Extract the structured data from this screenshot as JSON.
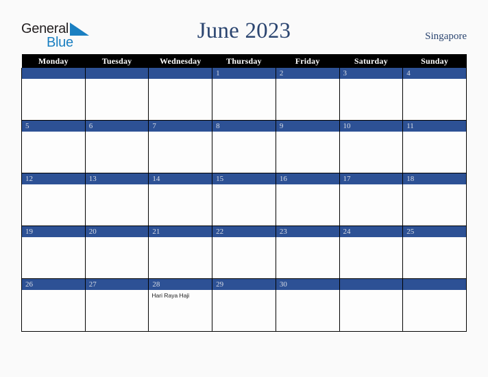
{
  "logo": {
    "line1": "General",
    "line2": "Blue",
    "triangle_color": "#1a7fc1",
    "text_color": "#231f20"
  },
  "header": {
    "title": "June 2023",
    "region": "Singapore",
    "title_color": "#2b4570"
  },
  "theme": {
    "band_blue": "#2d5195",
    "header_black": "#000000",
    "page_background": "#fafafa",
    "cell_background": "#fdfdfd",
    "daynum_color": "#d9dde6"
  },
  "calendar": {
    "weekday_headers": [
      "Monday",
      "Tuesday",
      "Wednesday",
      "Thursday",
      "Friday",
      "Saturday",
      "Sunday"
    ],
    "weeks": [
      [
        {
          "day": "",
          "events": []
        },
        {
          "day": "",
          "events": []
        },
        {
          "day": "",
          "events": []
        },
        {
          "day": "1",
          "events": []
        },
        {
          "day": "2",
          "events": []
        },
        {
          "day": "3",
          "events": []
        },
        {
          "day": "4",
          "events": []
        }
      ],
      [
        {
          "day": "5",
          "events": []
        },
        {
          "day": "6",
          "events": []
        },
        {
          "day": "7",
          "events": []
        },
        {
          "day": "8",
          "events": []
        },
        {
          "day": "9",
          "events": []
        },
        {
          "day": "10",
          "events": []
        },
        {
          "day": "11",
          "events": []
        }
      ],
      [
        {
          "day": "12",
          "events": []
        },
        {
          "day": "13",
          "events": []
        },
        {
          "day": "14",
          "events": []
        },
        {
          "day": "15",
          "events": []
        },
        {
          "day": "16",
          "events": []
        },
        {
          "day": "17",
          "events": []
        },
        {
          "day": "18",
          "events": []
        }
      ],
      [
        {
          "day": "19",
          "events": []
        },
        {
          "day": "20",
          "events": []
        },
        {
          "day": "21",
          "events": []
        },
        {
          "day": "22",
          "events": []
        },
        {
          "day": "23",
          "events": []
        },
        {
          "day": "24",
          "events": []
        },
        {
          "day": "25",
          "events": []
        }
      ],
      [
        {
          "day": "26",
          "events": []
        },
        {
          "day": "27",
          "events": []
        },
        {
          "day": "28",
          "events": [
            "Hari Raya Haji"
          ]
        },
        {
          "day": "29",
          "events": []
        },
        {
          "day": "30",
          "events": []
        },
        {
          "day": "",
          "events": []
        },
        {
          "day": "",
          "events": []
        }
      ]
    ]
  }
}
